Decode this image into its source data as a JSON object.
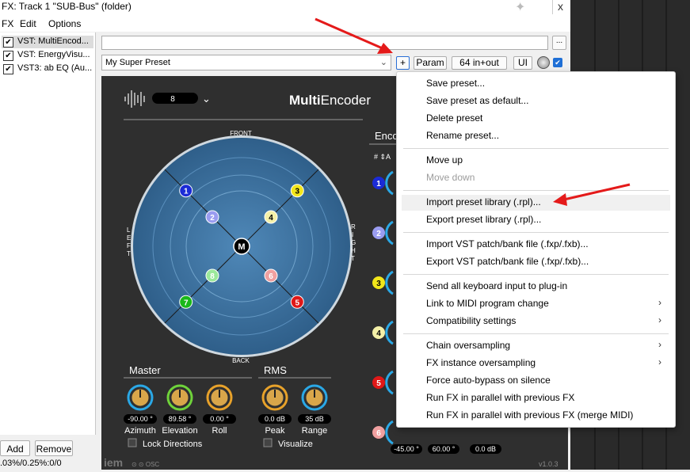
{
  "window": {
    "title": "FX: Track 1 \"SUB-Bus\" (folder)",
    "close": "x"
  },
  "menubar": [
    "FX",
    "Edit",
    "Options"
  ],
  "fx_chain": [
    {
      "label": "VST: MultiEncod...",
      "checked": true
    },
    {
      "label": "VST: EnergyVisu...",
      "checked": true
    },
    {
      "label": "VST3: ab EQ (Au...",
      "checked": true
    }
  ],
  "buttons": {
    "add": "Add",
    "remove": "Remove",
    "ellipsis": "...",
    "plus": "+",
    "param": "Param",
    "io": "64 in+out",
    "ui": "UI"
  },
  "status_text": ".03%/0.25%:0/0",
  "preset": {
    "value": "My Super Preset"
  },
  "plugin": {
    "title_bold": "Multi",
    "title_rest": "Encoder",
    "order_value": "8",
    "panner_labels": {
      "front": "FRONT",
      "back": "BACK",
      "left": "LEFT",
      "right": "RIGHT"
    },
    "points": [
      {
        "id": "1",
        "color": "#1b2bd6",
        "tc": "#fff",
        "angle": -45,
        "r": 0.93
      },
      {
        "id": "2",
        "color": "#9a9cf0",
        "tc": "#fff",
        "angle": -45,
        "r": 0.49
      },
      {
        "id": "3",
        "color": "#f2e61a",
        "tc": "#000",
        "angle": 45,
        "r": 0.93
      },
      {
        "id": "4",
        "color": "#f4f0a8",
        "tc": "#000",
        "angle": 45,
        "r": 0.49
      },
      {
        "id": "5",
        "color": "#e01818",
        "tc": "#fff",
        "angle": 135,
        "r": 0.93
      },
      {
        "id": "6",
        "color": "#f0a0a0",
        "tc": "#fff",
        "angle": 135,
        "r": 0.49
      },
      {
        "id": "7",
        "color": "#1ab81a",
        "tc": "#fff",
        "angle": -135,
        "r": 0.93
      },
      {
        "id": "8",
        "color": "#9be89b",
        "tc": "#fff",
        "angle": -135,
        "r": 0.49
      }
    ],
    "master": {
      "heading": "Master",
      "knobs": [
        {
          "value": "-90.00 °",
          "label": "Azimuth",
          "color": "#2aa8e6"
        },
        {
          "value": "89.58 °",
          "label": "Elevation",
          "color": "#6fd33a"
        },
        {
          "value": "0.00 °",
          "label": "Roll",
          "color": "#e8a22a"
        }
      ],
      "lock": "Lock Directions"
    },
    "rms": {
      "heading": "RMS",
      "knobs": [
        {
          "value": "0.0 dB",
          "label": "Peak",
          "color": "#e8a22a"
        },
        {
          "value": "35 dB",
          "label": "Range",
          "color": "#2aa8e6"
        }
      ],
      "visualize": "Visualize"
    },
    "encoder_heading": "Enco",
    "encoder_cols": "# ⇕A",
    "encoder_rows": [
      {
        "id": "1",
        "color": "#1b2bd6",
        "tc": "#fff"
      },
      {
        "id": "2",
        "color": "#9a9cf0",
        "tc": "#fff"
      },
      {
        "id": "3",
        "color": "#f2e61a",
        "tc": "#000"
      },
      {
        "id": "4",
        "color": "#f4f0a8",
        "tc": "#000"
      },
      {
        "id": "5",
        "color": "#e01818",
        "tc": "#fff"
      },
      {
        "id": "6",
        "color": "#f0a0a0",
        "tc": "#fff"
      }
    ],
    "bottom_values": [
      "-45.00 °",
      "60.00 °",
      "0.0 dB"
    ],
    "brand": "iem",
    "osc": "OSC",
    "version": "v1.0.3"
  },
  "context_menu": [
    {
      "label": "Save preset..."
    },
    {
      "label": "Save preset as default..."
    },
    {
      "label": "Delete preset"
    },
    {
      "label": "Rename preset..."
    },
    {
      "label": "Move up"
    },
    {
      "label": "Move down",
      "disabled": true
    },
    {
      "label": "Import preset library (.rpl)...",
      "highlighted": true
    },
    {
      "label": "Export preset library (.rpl)..."
    },
    {
      "label": "Import VST patch/bank file (.fxp/.fxb)..."
    },
    {
      "label": "Export VST patch/bank file (.fxp/.fxb)..."
    },
    {
      "label": "Send all keyboard input to plug-in"
    },
    {
      "label": "Link to MIDI program change",
      "submenu": true
    },
    {
      "label": "Compatibility settings",
      "submenu": true
    },
    {
      "label": "Chain oversampling",
      "submenu": true
    },
    {
      "label": "FX instance oversampling",
      "submenu": true
    },
    {
      "label": "Force auto-bypass on silence"
    },
    {
      "label": "Run FX in parallel with previous FX"
    },
    {
      "label": "Run FX in parallel with previous FX (merge MIDI)"
    }
  ],
  "colors": {
    "annotation_arrow": "#e41a1a",
    "plugin_bg": "#2f2f2f",
    "sphere": "#3d6f9a"
  }
}
